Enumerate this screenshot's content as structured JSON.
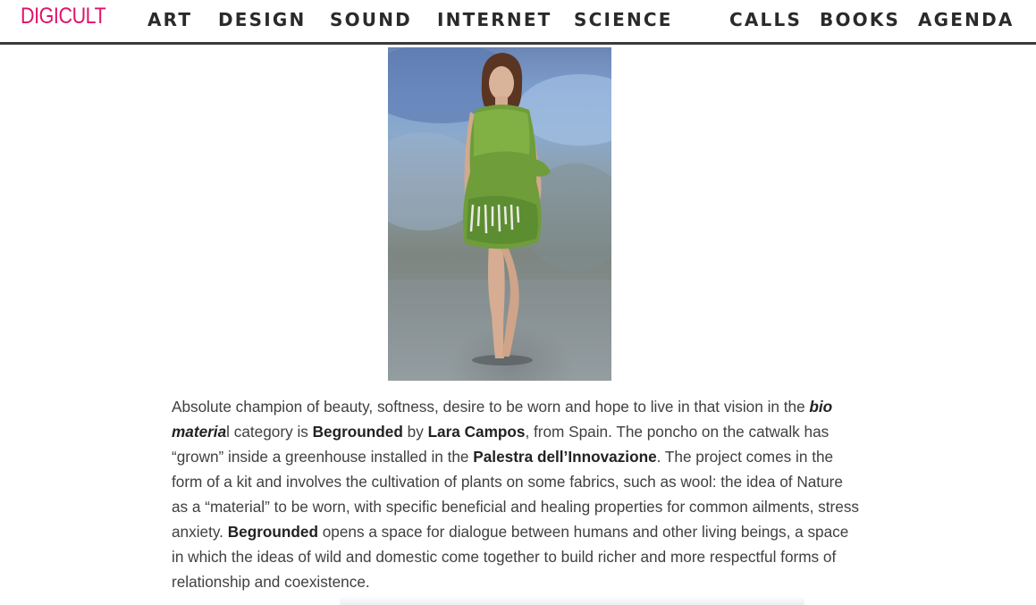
{
  "brand": {
    "logo": "DIGICULT",
    "color": "#e0126a"
  },
  "nav": {
    "left": [
      "ART",
      "DESIGN",
      "SOUND",
      "INTERNET",
      "SCIENCE"
    ],
    "right": [
      "CALLS",
      "BOOKS",
      "AGENDA"
    ]
  },
  "hero": {
    "subject": "model on catwalk wearing green grown-grass dress"
  },
  "article": {
    "p1": "Absolute champion of beauty, softness, desire to be worn and hope to live in that vision in the ",
    "category_em": "bio materia",
    "p2": "l category is ",
    "project": "Begrounded",
    "p3": " by ",
    "designer": "Lara Campos",
    "p4": ", from Spain. The poncho on the catwalk has “grown” inside a greenhouse installed in the ",
    "venue": "Palestra dell’Innovazione",
    "p5": ". The project comes in the form of a kit and involves the cultivation of plants on some fabrics, such as wool: the idea of Nature as a “material” to be worn, with specific beneficial and healing properties for common ailments, stress anxiety. ",
    "project2": "Begrounded",
    "p6": " opens a space for dialogue between humans and other living beings, a space in which the ideas of wild and domestic come together to build richer and more respectful forms of relationship and coexistence."
  }
}
